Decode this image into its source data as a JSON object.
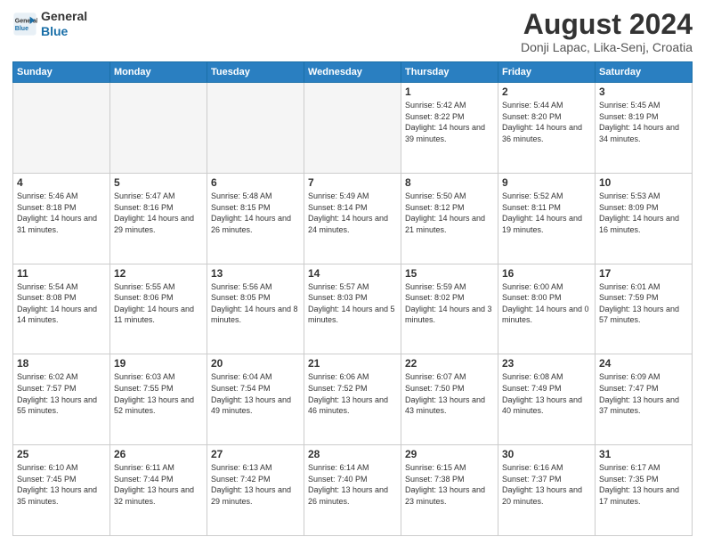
{
  "header": {
    "logo_line1": "General",
    "logo_line2": "Blue",
    "title": "August 2024",
    "subtitle": "Donji Lapac, Lika-Senj, Croatia"
  },
  "days_of_week": [
    "Sunday",
    "Monday",
    "Tuesday",
    "Wednesday",
    "Thursday",
    "Friday",
    "Saturday"
  ],
  "weeks": [
    [
      {
        "day": "",
        "empty": true
      },
      {
        "day": "",
        "empty": true
      },
      {
        "day": "",
        "empty": true
      },
      {
        "day": "",
        "empty": true
      },
      {
        "day": "1",
        "sunrise": "5:42 AM",
        "sunset": "8:22 PM",
        "daylight": "14 hours and 39 minutes."
      },
      {
        "day": "2",
        "sunrise": "5:44 AM",
        "sunset": "8:20 PM",
        "daylight": "14 hours and 36 minutes."
      },
      {
        "day": "3",
        "sunrise": "5:45 AM",
        "sunset": "8:19 PM",
        "daylight": "14 hours and 34 minutes."
      }
    ],
    [
      {
        "day": "4",
        "sunrise": "5:46 AM",
        "sunset": "8:18 PM",
        "daylight": "14 hours and 31 minutes."
      },
      {
        "day": "5",
        "sunrise": "5:47 AM",
        "sunset": "8:16 PM",
        "daylight": "14 hours and 29 minutes."
      },
      {
        "day": "6",
        "sunrise": "5:48 AM",
        "sunset": "8:15 PM",
        "daylight": "14 hours and 26 minutes."
      },
      {
        "day": "7",
        "sunrise": "5:49 AM",
        "sunset": "8:14 PM",
        "daylight": "14 hours and 24 minutes."
      },
      {
        "day": "8",
        "sunrise": "5:50 AM",
        "sunset": "8:12 PM",
        "daylight": "14 hours and 21 minutes."
      },
      {
        "day": "9",
        "sunrise": "5:52 AM",
        "sunset": "8:11 PM",
        "daylight": "14 hours and 19 minutes."
      },
      {
        "day": "10",
        "sunrise": "5:53 AM",
        "sunset": "8:09 PM",
        "daylight": "14 hours and 16 minutes."
      }
    ],
    [
      {
        "day": "11",
        "sunrise": "5:54 AM",
        "sunset": "8:08 PM",
        "daylight": "14 hours and 14 minutes."
      },
      {
        "day": "12",
        "sunrise": "5:55 AM",
        "sunset": "8:06 PM",
        "daylight": "14 hours and 11 minutes."
      },
      {
        "day": "13",
        "sunrise": "5:56 AM",
        "sunset": "8:05 PM",
        "daylight": "14 hours and 8 minutes."
      },
      {
        "day": "14",
        "sunrise": "5:57 AM",
        "sunset": "8:03 PM",
        "daylight": "14 hours and 5 minutes."
      },
      {
        "day": "15",
        "sunrise": "5:59 AM",
        "sunset": "8:02 PM",
        "daylight": "14 hours and 3 minutes."
      },
      {
        "day": "16",
        "sunrise": "6:00 AM",
        "sunset": "8:00 PM",
        "daylight": "14 hours and 0 minutes."
      },
      {
        "day": "17",
        "sunrise": "6:01 AM",
        "sunset": "7:59 PM",
        "daylight": "13 hours and 57 minutes."
      }
    ],
    [
      {
        "day": "18",
        "sunrise": "6:02 AM",
        "sunset": "7:57 PM",
        "daylight": "13 hours and 55 minutes."
      },
      {
        "day": "19",
        "sunrise": "6:03 AM",
        "sunset": "7:55 PM",
        "daylight": "13 hours and 52 minutes."
      },
      {
        "day": "20",
        "sunrise": "6:04 AM",
        "sunset": "7:54 PM",
        "daylight": "13 hours and 49 minutes."
      },
      {
        "day": "21",
        "sunrise": "6:06 AM",
        "sunset": "7:52 PM",
        "daylight": "13 hours and 46 minutes."
      },
      {
        "day": "22",
        "sunrise": "6:07 AM",
        "sunset": "7:50 PM",
        "daylight": "13 hours and 43 minutes."
      },
      {
        "day": "23",
        "sunrise": "6:08 AM",
        "sunset": "7:49 PM",
        "daylight": "13 hours and 40 minutes."
      },
      {
        "day": "24",
        "sunrise": "6:09 AM",
        "sunset": "7:47 PM",
        "daylight": "13 hours and 37 minutes."
      }
    ],
    [
      {
        "day": "25",
        "sunrise": "6:10 AM",
        "sunset": "7:45 PM",
        "daylight": "13 hours and 35 minutes."
      },
      {
        "day": "26",
        "sunrise": "6:11 AM",
        "sunset": "7:44 PM",
        "daylight": "13 hours and 32 minutes."
      },
      {
        "day": "27",
        "sunrise": "6:13 AM",
        "sunset": "7:42 PM",
        "daylight": "13 hours and 29 minutes."
      },
      {
        "day": "28",
        "sunrise": "6:14 AM",
        "sunset": "7:40 PM",
        "daylight": "13 hours and 26 minutes."
      },
      {
        "day": "29",
        "sunrise": "6:15 AM",
        "sunset": "7:38 PM",
        "daylight": "13 hours and 23 minutes."
      },
      {
        "day": "30",
        "sunrise": "6:16 AM",
        "sunset": "7:37 PM",
        "daylight": "13 hours and 20 minutes."
      },
      {
        "day": "31",
        "sunrise": "6:17 AM",
        "sunset": "7:35 PM",
        "daylight": "13 hours and 17 minutes."
      }
    ]
  ],
  "labels": {
    "sunrise_label": "Sunrise:",
    "sunset_label": "Sunset:",
    "daylight_label": "Daylight:"
  }
}
